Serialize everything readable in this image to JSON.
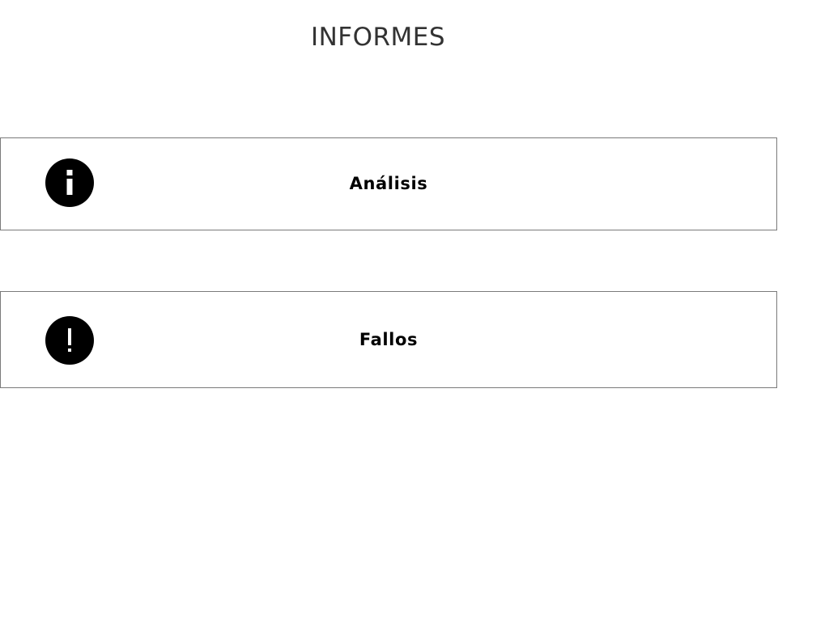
{
  "header": {
    "title": "INFORMES"
  },
  "reports": [
    {
      "label": "Análisis",
      "icon": "info-icon"
    },
    {
      "label": "Fallos",
      "icon": "alert-icon"
    }
  ],
  "colors": {
    "title": "#333333",
    "icon_background": "#000000",
    "icon_glyph": "#ffffff",
    "card_border": "#7a7a7a",
    "label": "#000000"
  }
}
